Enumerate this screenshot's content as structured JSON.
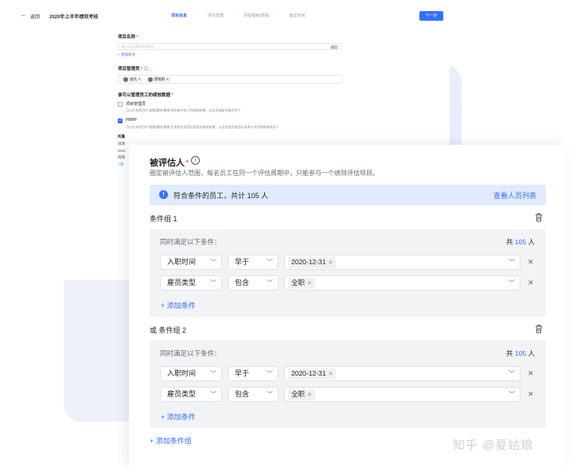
{
  "header": {
    "back_label": "返回",
    "page_title": "2020年上半年绩效考核",
    "steps": [
      "项目信息",
      "评估范围",
      "评估模板/流程",
      "能正时间"
    ],
    "next_button": "下一步"
  },
  "form": {
    "name_label": "项目名称",
    "name_placeholder": "例: 2020 绩效评估项目",
    "name_tag": "模型",
    "add_alias": "+ 添加条文",
    "manager_label": "项目管理员",
    "managers": [
      "张凡",
      "李晓阳"
    ],
    "perm_label": "谁可以管理员工的绩效数据",
    "perm_options": [
      {
        "label": "项目管理员",
        "desc": "可以在本项目中 查看/删除/撤销 所有被评估人的绩效结果，以及添加新的被评估人",
        "checked": false
      },
      {
        "label": "HRBP",
        "desc": "可以在本项目中 查看/删除/撤销 负责的业务团队成员的绩效结果，以及添加负责团队未参与评估的新被评估人",
        "checked": true
      }
    ],
    "extra_lines": [
      "所属",
      "周期",
      "2021",
      "周期",
      "+添"
    ]
  },
  "evaluatee": {
    "title": "被评估人",
    "required_mark": "*",
    "description": "圈定被评估人范围，每名员工在同一个评估周期中，只能参与一个绩效评估项目。",
    "banner_text": "符合条件的员工，共计 105 人",
    "banner_link": "查看人员列表",
    "group_prefix": "或",
    "groups": [
      {
        "title": "条件组 1",
        "head": "同时满足以下条件：",
        "count_prefix": "共",
        "count": "105",
        "count_suffix": "人",
        "rows": [
          {
            "field": "入职时间",
            "op": "早于",
            "value": "2020-12-31"
          },
          {
            "field": "雇员类型",
            "op": "包含",
            "value": "全职"
          }
        ],
        "add_condition": "+ 添加条件"
      },
      {
        "title": "条件组 2",
        "head": "同时满足以下条件：",
        "count_prefix": "共",
        "count": "105",
        "count_suffix": "人",
        "rows": [
          {
            "field": "入职时间",
            "op": "早于",
            "value": "2020-12-31"
          },
          {
            "field": "雇员类型",
            "op": "包含",
            "value": "全职"
          }
        ],
        "add_condition": "+ 添加条件"
      }
    ],
    "add_group": "+ 添加条件组"
  },
  "watermark": "知乎 @夏姑娘",
  "colors": {
    "accent": "#3370ff",
    "banner_bg": "#e1eaff",
    "group_bg": "#f2f3f5"
  },
  "icons": [
    "back-arrow-icon",
    "info-icon",
    "trash-icon",
    "chevron-down-icon",
    "close-icon",
    "checkbox-icon"
  ]
}
